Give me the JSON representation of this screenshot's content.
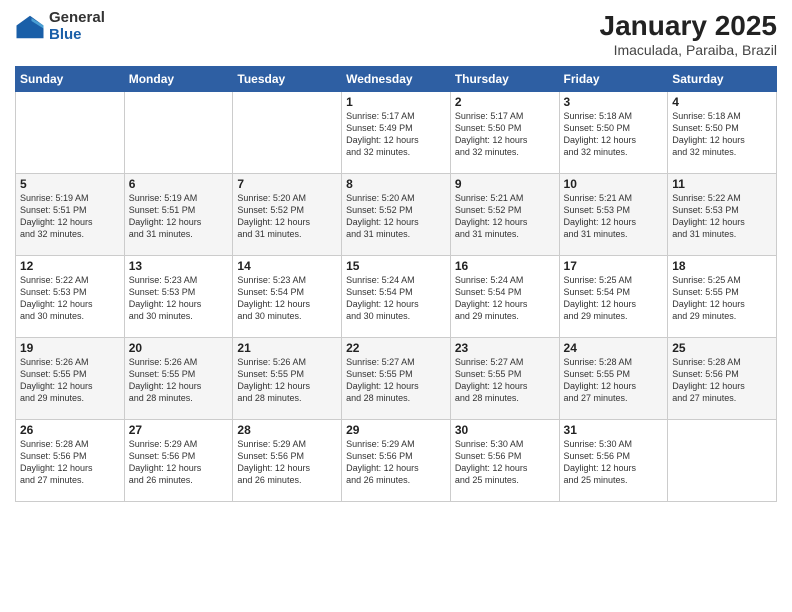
{
  "header": {
    "logo": {
      "general": "General",
      "blue": "Blue"
    },
    "title": "January 2025",
    "subtitle": "Imaculada, Paraiba, Brazil"
  },
  "days_of_week": [
    "Sunday",
    "Monday",
    "Tuesday",
    "Wednesday",
    "Thursday",
    "Friday",
    "Saturday"
  ],
  "weeks": [
    [
      {
        "day": "",
        "text": ""
      },
      {
        "day": "",
        "text": ""
      },
      {
        "day": "",
        "text": ""
      },
      {
        "day": "1",
        "text": "Sunrise: 5:17 AM\nSunset: 5:49 PM\nDaylight: 12 hours\nand 32 minutes."
      },
      {
        "day": "2",
        "text": "Sunrise: 5:17 AM\nSunset: 5:50 PM\nDaylight: 12 hours\nand 32 minutes."
      },
      {
        "day": "3",
        "text": "Sunrise: 5:18 AM\nSunset: 5:50 PM\nDaylight: 12 hours\nand 32 minutes."
      },
      {
        "day": "4",
        "text": "Sunrise: 5:18 AM\nSunset: 5:50 PM\nDaylight: 12 hours\nand 32 minutes."
      }
    ],
    [
      {
        "day": "5",
        "text": "Sunrise: 5:19 AM\nSunset: 5:51 PM\nDaylight: 12 hours\nand 32 minutes."
      },
      {
        "day": "6",
        "text": "Sunrise: 5:19 AM\nSunset: 5:51 PM\nDaylight: 12 hours\nand 31 minutes."
      },
      {
        "day": "7",
        "text": "Sunrise: 5:20 AM\nSunset: 5:52 PM\nDaylight: 12 hours\nand 31 minutes."
      },
      {
        "day": "8",
        "text": "Sunrise: 5:20 AM\nSunset: 5:52 PM\nDaylight: 12 hours\nand 31 minutes."
      },
      {
        "day": "9",
        "text": "Sunrise: 5:21 AM\nSunset: 5:52 PM\nDaylight: 12 hours\nand 31 minutes."
      },
      {
        "day": "10",
        "text": "Sunrise: 5:21 AM\nSunset: 5:53 PM\nDaylight: 12 hours\nand 31 minutes."
      },
      {
        "day": "11",
        "text": "Sunrise: 5:22 AM\nSunset: 5:53 PM\nDaylight: 12 hours\nand 31 minutes."
      }
    ],
    [
      {
        "day": "12",
        "text": "Sunrise: 5:22 AM\nSunset: 5:53 PM\nDaylight: 12 hours\nand 30 minutes."
      },
      {
        "day": "13",
        "text": "Sunrise: 5:23 AM\nSunset: 5:53 PM\nDaylight: 12 hours\nand 30 minutes."
      },
      {
        "day": "14",
        "text": "Sunrise: 5:23 AM\nSunset: 5:54 PM\nDaylight: 12 hours\nand 30 minutes."
      },
      {
        "day": "15",
        "text": "Sunrise: 5:24 AM\nSunset: 5:54 PM\nDaylight: 12 hours\nand 30 minutes."
      },
      {
        "day": "16",
        "text": "Sunrise: 5:24 AM\nSunset: 5:54 PM\nDaylight: 12 hours\nand 29 minutes."
      },
      {
        "day": "17",
        "text": "Sunrise: 5:25 AM\nSunset: 5:54 PM\nDaylight: 12 hours\nand 29 minutes."
      },
      {
        "day": "18",
        "text": "Sunrise: 5:25 AM\nSunset: 5:55 PM\nDaylight: 12 hours\nand 29 minutes."
      }
    ],
    [
      {
        "day": "19",
        "text": "Sunrise: 5:26 AM\nSunset: 5:55 PM\nDaylight: 12 hours\nand 29 minutes."
      },
      {
        "day": "20",
        "text": "Sunrise: 5:26 AM\nSunset: 5:55 PM\nDaylight: 12 hours\nand 28 minutes."
      },
      {
        "day": "21",
        "text": "Sunrise: 5:26 AM\nSunset: 5:55 PM\nDaylight: 12 hours\nand 28 minutes."
      },
      {
        "day": "22",
        "text": "Sunrise: 5:27 AM\nSunset: 5:55 PM\nDaylight: 12 hours\nand 28 minutes."
      },
      {
        "day": "23",
        "text": "Sunrise: 5:27 AM\nSunset: 5:55 PM\nDaylight: 12 hours\nand 28 minutes."
      },
      {
        "day": "24",
        "text": "Sunrise: 5:28 AM\nSunset: 5:55 PM\nDaylight: 12 hours\nand 27 minutes."
      },
      {
        "day": "25",
        "text": "Sunrise: 5:28 AM\nSunset: 5:56 PM\nDaylight: 12 hours\nand 27 minutes."
      }
    ],
    [
      {
        "day": "26",
        "text": "Sunrise: 5:28 AM\nSunset: 5:56 PM\nDaylight: 12 hours\nand 27 minutes."
      },
      {
        "day": "27",
        "text": "Sunrise: 5:29 AM\nSunset: 5:56 PM\nDaylight: 12 hours\nand 26 minutes."
      },
      {
        "day": "28",
        "text": "Sunrise: 5:29 AM\nSunset: 5:56 PM\nDaylight: 12 hours\nand 26 minutes."
      },
      {
        "day": "29",
        "text": "Sunrise: 5:29 AM\nSunset: 5:56 PM\nDaylight: 12 hours\nand 26 minutes."
      },
      {
        "day": "30",
        "text": "Sunrise: 5:30 AM\nSunset: 5:56 PM\nDaylight: 12 hours\nand 25 minutes."
      },
      {
        "day": "31",
        "text": "Sunrise: 5:30 AM\nSunset: 5:56 PM\nDaylight: 12 hours\nand 25 minutes."
      },
      {
        "day": "",
        "text": ""
      }
    ]
  ]
}
